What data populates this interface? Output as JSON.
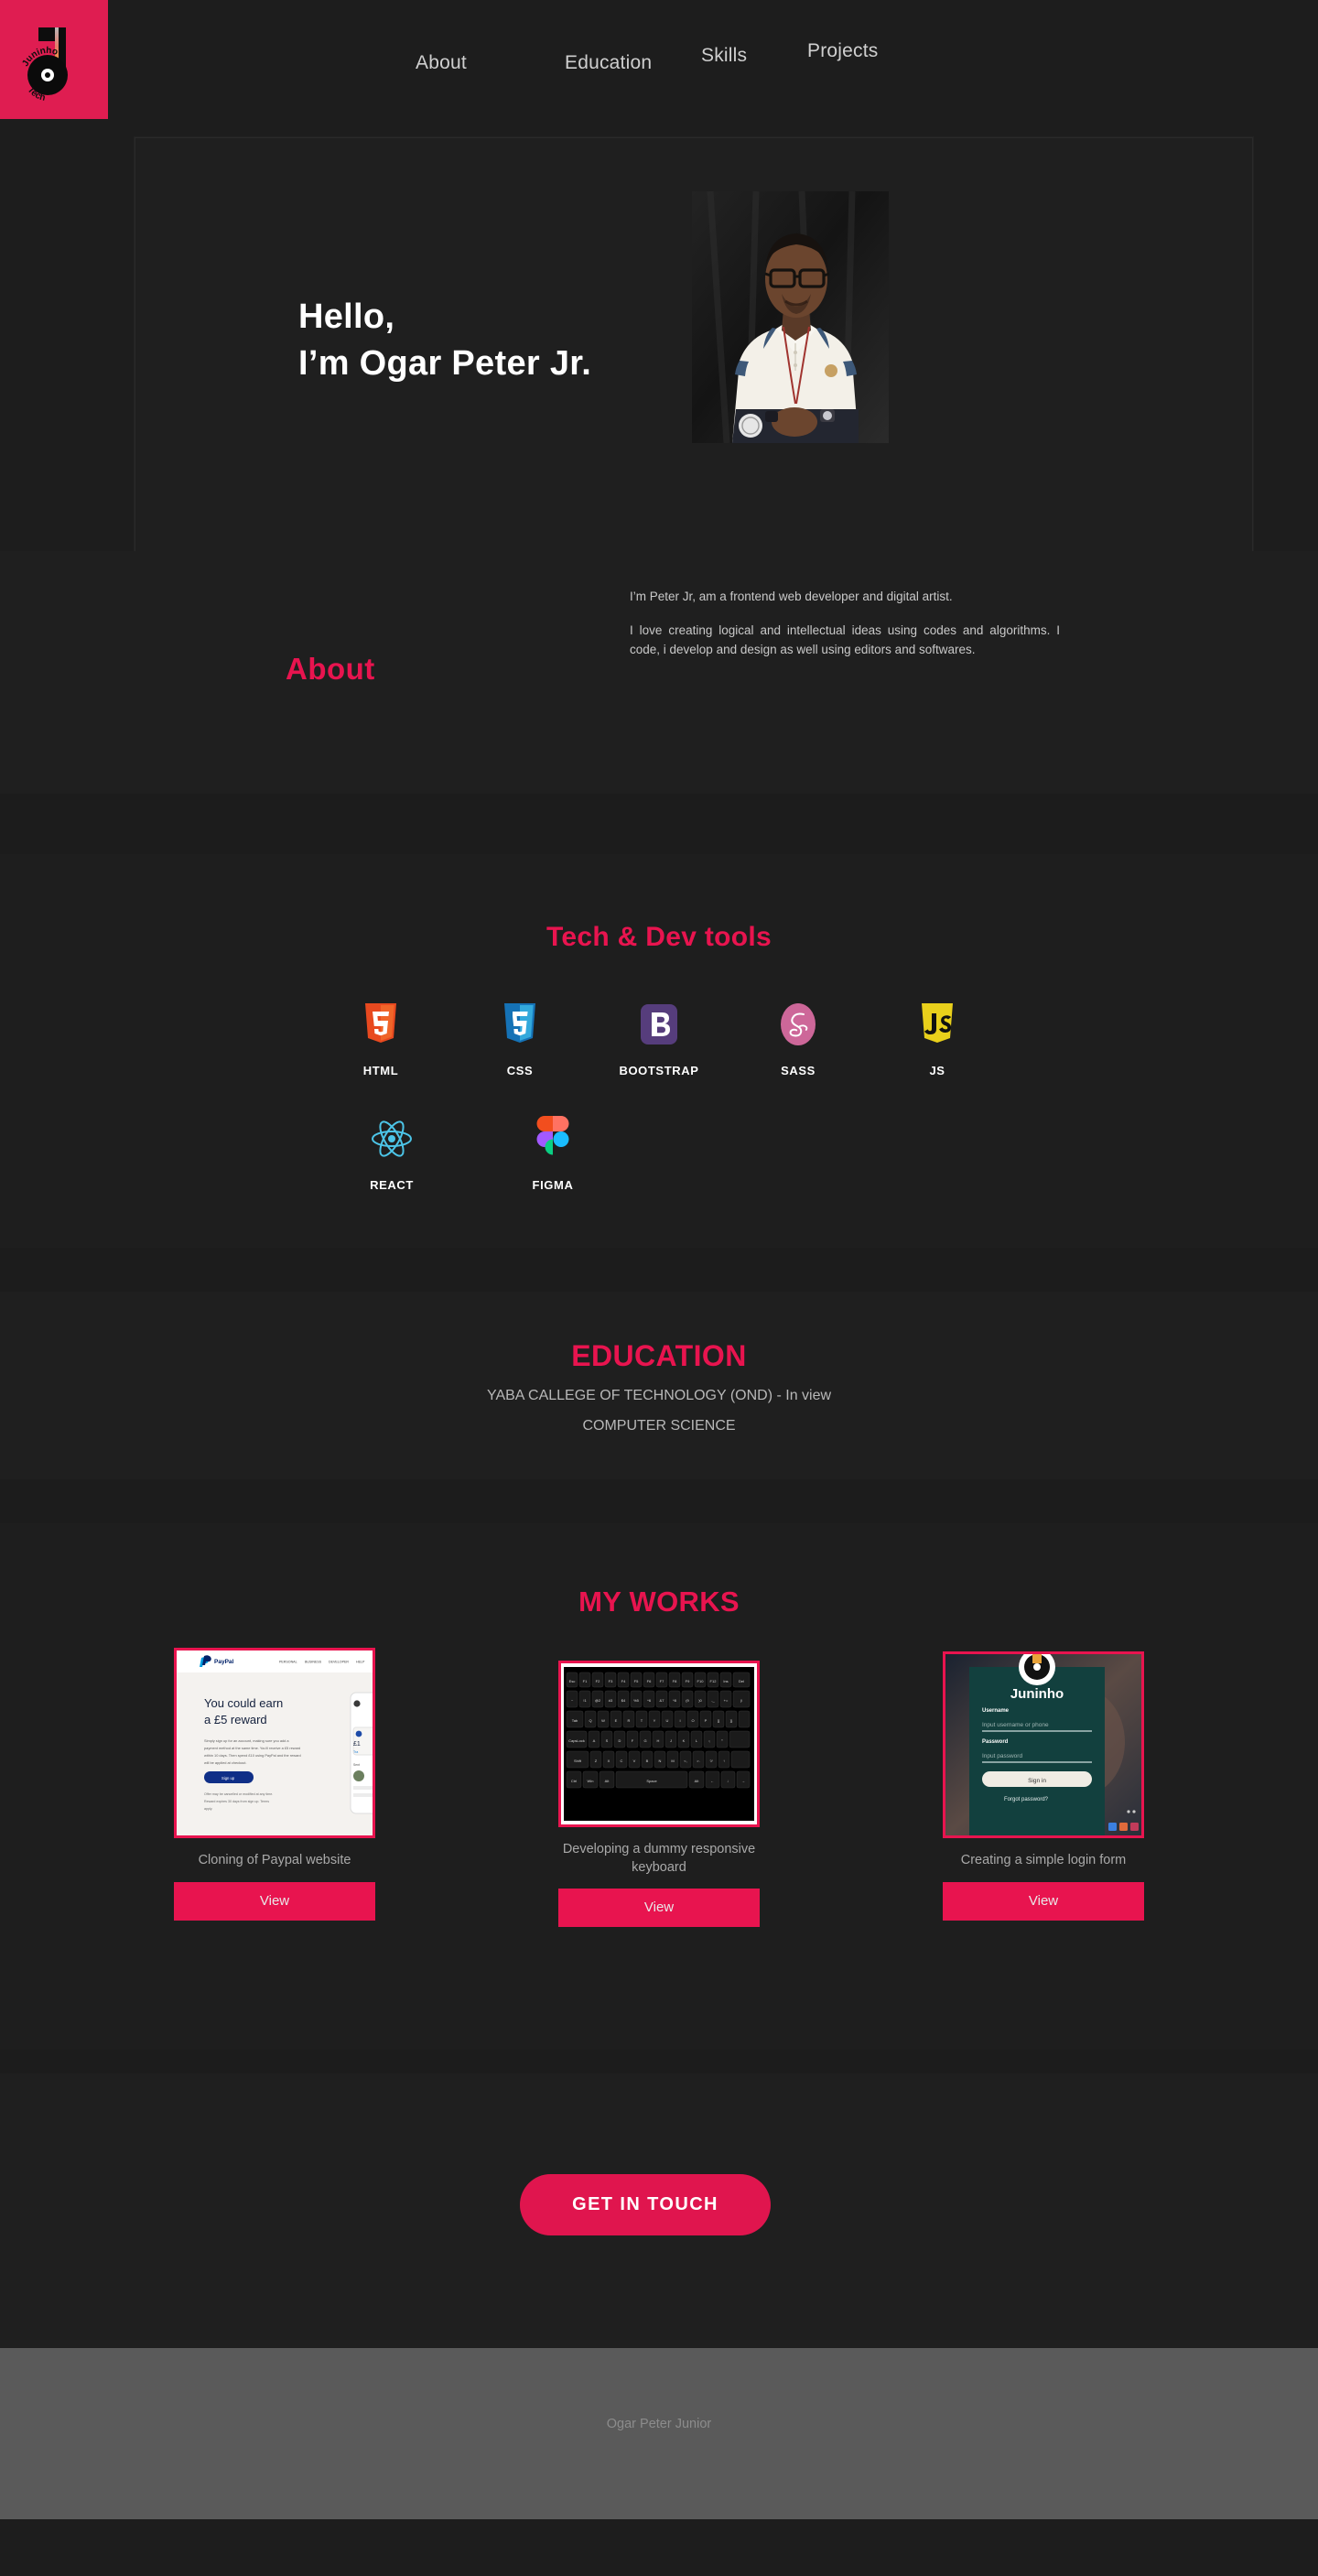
{
  "brand": {
    "logo_alt": "Juninho Tech",
    "logo_word_top": "Juninho",
    "logo_word_bottom": "Tech",
    "accent_color": "#e8144f",
    "logo_bg_color": "#df1d51",
    "page_bg_color": "#1d1d1d"
  },
  "nav": {
    "items": [
      {
        "label": "About"
      },
      {
        "label": "Education"
      },
      {
        "label": "Skills"
      },
      {
        "label": "Projects"
      }
    ]
  },
  "hero": {
    "greeting": "Hello,",
    "name_line": "I’m Ogar Peter Jr.",
    "photo_alt": "Portrait of Ogar Peter Jr. in a white polo shirt"
  },
  "about": {
    "title": "About",
    "paragraph_1": "I’m Peter Jr, am a frontend web developer and digital artist.",
    "paragraph_2": "I love creating logical and intellectual ideas using codes and algorithms. I code, i develop and design as well using editors and softwares."
  },
  "tech": {
    "title": "Tech & Dev tools",
    "row1": [
      {
        "label": "HTML",
        "icon": "html5-icon"
      },
      {
        "label": "CSS",
        "icon": "css3-icon"
      },
      {
        "label": "BOOTSTRAP",
        "icon": "bootstrap-icon"
      },
      {
        "label": "SASS",
        "icon": "sass-icon"
      },
      {
        "label": "JS",
        "icon": "javascript-icon"
      }
    ],
    "row2": [
      {
        "label": "REACT",
        "icon": "react-icon"
      },
      {
        "label": "FIGMA",
        "icon": "figma-icon"
      }
    ]
  },
  "education": {
    "title": "EDUCATION",
    "school": "YABA CALLEGE OF TECHNOLOGY (OND)  - In view",
    "course": "COMPUTER SCIENCE"
  },
  "works": {
    "title": "MY WORKS",
    "items": [
      {
        "caption": "Cloning of Paypal website",
        "button": "View",
        "thumb_alt": "paypal-clone-screenshot",
        "thumb": {
          "brand": "PayPal",
          "nav": [
            "PERSONAL",
            "BUSINESS",
            "DEVELOPER",
            "HELP"
          ],
          "headline_1": "You could earn",
          "headline_2": "a £5 reward",
          "body": "Simply sign up for an account, making sure you add a payment method at the same time. You’ll receive a £5 reward within 10 days. Then spend £10 using PayPal and the reward will be applied at checkout.",
          "cta": "Sign up",
          "fineprint": "Offer may be cancelled or modified at any time. Reward expires 30 days from sign up. Terms apply."
        }
      },
      {
        "caption": "Developing  a dummy responsive keyboard",
        "button": "View",
        "thumb_alt": "responsive-keyboard-screenshot",
        "thumb": {
          "row_fn": [
            "Esc",
            "F1",
            "F2",
            "F3",
            "F4",
            "F5",
            "F6",
            "F7",
            "F8",
            "F9",
            "F10",
            "F12",
            "Ins",
            "Del"
          ],
          "row_num": [
            "~`",
            "!1",
            "@2",
            "#3",
            "$4",
            "%5",
            "^6",
            "&7",
            "*8",
            "(9",
            ")0",
            "-_",
            "+=",
            "|\\"
          ],
          "row_q": [
            "Tab",
            "Q",
            "W",
            "E",
            "R",
            "T",
            "Y",
            "U",
            "I",
            "O",
            "P",
            "[{",
            "]}"
          ],
          "row_a": [
            "CapsLock",
            "A",
            "S",
            "D",
            "F",
            "G",
            "H",
            "J",
            "K",
            "L",
            ":;",
            "\"'"
          ],
          "row_z": [
            "Shift",
            "Z",
            "X",
            "C",
            "V",
            "B",
            "N",
            "M",
            "<,",
            ">.",
            "?/",
            "↑"
          ],
          "row_space": [
            "Ctrl",
            "Win",
            "Alt",
            "Space",
            "Alt",
            "←",
            "↓",
            "→"
          ]
        }
      },
      {
        "caption": "Creating a simple login form",
        "button": "View",
        "thumb_alt": "juninho-login-form-screenshot",
        "thumb": {
          "app_name": "Juninho",
          "username_label": "Username",
          "username_placeholder": "Input username or phone",
          "password_label": "Password",
          "password_placeholder": "Input password",
          "submit": "Sign in",
          "forgot": "Forgot password?"
        }
      }
    ]
  },
  "contact": {
    "button": "GET IN TOUCH"
  },
  "footer": {
    "text": "Ogar Peter Junior"
  }
}
